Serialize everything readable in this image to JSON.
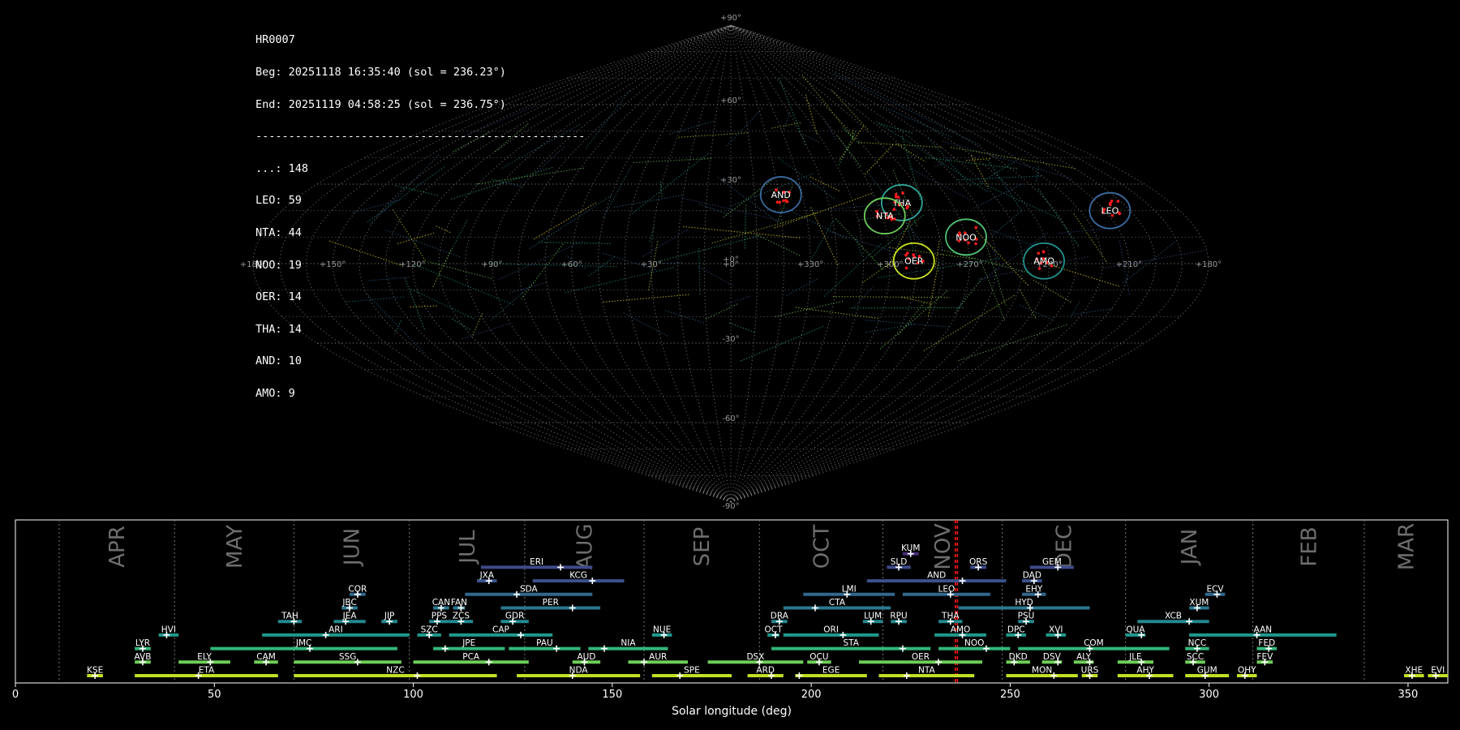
{
  "info": {
    "station": "HR0007",
    "beg": "Beg: 20251118 16:35:40 (sol = 236.23°)",
    "end": "End: 20251119 04:58:25 (sol = 236.75°)",
    "separator": "--------------------------------------------------",
    "counts": [
      "...: 148",
      "LEO: 59",
      "NTA: 44",
      "NOO: 19",
      "OER: 14",
      "THA: 14",
      "AND: 10",
      "AMO: 9"
    ]
  },
  "sky_map": {
    "projection": "sinusoidal",
    "lat_labels": [
      "+90°",
      "+60°",
      "+30°",
      "+0°",
      "-30°",
      "-60°",
      "-90°"
    ],
    "lon_labels": [
      "+180°",
      "+150°",
      "+120°",
      "+90°",
      "+60°",
      "+30°",
      "+0°",
      "+330°",
      "+300°",
      "+270°",
      "+240°",
      "+210°",
      "+180°"
    ],
    "radiants": [
      {
        "code": "LEO",
        "ra": 152,
        "dec": 20
      },
      {
        "code": "THA",
        "ra": 70,
        "dec": 23
      },
      {
        "code": "AND",
        "ra": 21,
        "dec": 26
      },
      {
        "code": "NTA",
        "ra": 61,
        "dec": 18
      },
      {
        "code": "NOO",
        "ra": 90,
        "dec": 10
      },
      {
        "code": "AMO",
        "ra": 118,
        "dec": 1
      },
      {
        "code": "OER",
        "ra": 69,
        "dec": 1
      }
    ],
    "colors": {
      "LEO": "#3b6ba0",
      "THA": "#2ea79a",
      "AND": "#3b6ba0",
      "NTA": "#6ccc5a",
      "NOO": "#4fbf74",
      "AMO": "#21918c",
      "OER": "#c9e21f"
    }
  },
  "chart_data": {
    "type": "timeline",
    "xlabel": "Solar longitude (deg)",
    "xlim": [
      0,
      360
    ],
    "xticks": [
      0,
      50,
      100,
      150,
      200,
      250,
      300,
      350
    ],
    "current_sol": [
      236.23,
      236.75
    ],
    "months": [
      {
        "name": "APR",
        "start": 11
      },
      {
        "name": "MAY",
        "start": 40
      },
      {
        "name": "JUN",
        "start": 70
      },
      {
        "name": "JUL",
        "start": 99
      },
      {
        "name": "AUG",
        "start": 128
      },
      {
        "name": "SEP",
        "start": 158
      },
      {
        "name": "OCT",
        "start": 187
      },
      {
        "name": "NOV",
        "start": 218
      },
      {
        "name": "DEC",
        "start": 248
      },
      {
        "name": "JAN",
        "start": 279
      },
      {
        "name": "FEB",
        "start": 311
      },
      {
        "name": "MAR",
        "start": 339
      }
    ],
    "showers": [
      {
        "code": "KUM",
        "start": 223,
        "end": 227,
        "peak": 225,
        "row": 10,
        "color": "#472d7b"
      },
      {
        "code": "ERI",
        "start": 117,
        "end": 145,
        "peak": 137,
        "row": 9,
        "color": "#3e4a89"
      },
      {
        "code": "SLD",
        "start": 219,
        "end": 225,
        "peak": 222,
        "row": 9,
        "color": "#3e4a89"
      },
      {
        "code": "ORS",
        "start": 240,
        "end": 244,
        "peak": 242,
        "row": 9,
        "color": "#3e4a89"
      },
      {
        "code": "GEM",
        "start": 255,
        "end": 266,
        "peak": 262,
        "row": 9,
        "color": "#3e4a89"
      },
      {
        "code": "JXA",
        "start": 116,
        "end": 121,
        "peak": 119,
        "row": 8,
        "color": "#3b528b"
      },
      {
        "code": "KCG",
        "start": 130,
        "end": 153,
        "peak": 145,
        "row": 8,
        "color": "#3b528b"
      },
      {
        "code": "AND",
        "start": 214,
        "end": 249,
        "peak": 238,
        "row": 8,
        "color": "#3b528b"
      },
      {
        "code": "DAD",
        "start": 253,
        "end": 258,
        "peak": 256,
        "row": 8,
        "color": "#3b528b"
      },
      {
        "code": "COR",
        "start": 84,
        "end": 88,
        "peak": 86,
        "row": 7,
        "color": "#31688e"
      },
      {
        "code": "SDA",
        "start": 113,
        "end": 145,
        "peak": 126,
        "row": 7,
        "color": "#31688e"
      },
      {
        "code": "LMI",
        "start": 198,
        "end": 221,
        "peak": 209,
        "row": 7,
        "color": "#31688e"
      },
      {
        "code": "LEO",
        "start": 223,
        "end": 245,
        "peak": 235,
        "row": 7,
        "color": "#31688e"
      },
      {
        "code": "EHY",
        "start": 253,
        "end": 259,
        "peak": 257,
        "row": 7,
        "color": "#31688e"
      },
      {
        "code": "ECV",
        "start": 299,
        "end": 304,
        "peak": 302,
        "row": 7,
        "color": "#31688e"
      },
      {
        "code": "JBC",
        "start": 82,
        "end": 86,
        "peak": 84,
        "row": 6,
        "color": "#2a788e"
      },
      {
        "code": "CAN",
        "start": 105,
        "end": 109,
        "peak": 107,
        "row": 6,
        "color": "#2a788e"
      },
      {
        "code": "FAN",
        "start": 110,
        "end": 113,
        "peak": 112,
        "row": 6,
        "color": "#2a788e"
      },
      {
        "code": "PER",
        "start": 122,
        "end": 147,
        "peak": 140,
        "row": 6,
        "color": "#2a788e"
      },
      {
        "code": "CTA",
        "start": 193,
        "end": 220,
        "peak": 201,
        "row": 6,
        "color": "#2a788e"
      },
      {
        "code": "HYD",
        "start": 237,
        "end": 270,
        "peak": 255,
        "row": 6,
        "color": "#2a788e"
      },
      {
        "code": "XUM",
        "start": 295,
        "end": 300,
        "peak": 297,
        "row": 6,
        "color": "#2a788e"
      },
      {
        "code": "TAH",
        "start": 66,
        "end": 72,
        "peak": 70,
        "row": 5,
        "color": "#23888e"
      },
      {
        "code": "JEA",
        "start": 80,
        "end": 88,
        "peak": 83,
        "row": 5,
        "color": "#23888e"
      },
      {
        "code": "JIP",
        "start": 92,
        "end": 96,
        "peak": 94,
        "row": 5,
        "color": "#23888e"
      },
      {
        "code": "PPS",
        "start": 104,
        "end": 109,
        "peak": 106,
        "row": 5,
        "color": "#23888e"
      },
      {
        "code": "ZCS",
        "start": 109,
        "end": 115,
        "peak": 112,
        "row": 5,
        "color": "#23888e"
      },
      {
        "code": "GDR",
        "start": 122,
        "end": 129,
        "peak": 125,
        "row": 5,
        "color": "#23888e"
      },
      {
        "code": "DRA",
        "start": 190,
        "end": 194,
        "peak": 192,
        "row": 5,
        "color": "#23888e"
      },
      {
        "code": "LUM",
        "start": 213,
        "end": 218,
        "peak": 215,
        "row": 5,
        "color": "#23888e"
      },
      {
        "code": "RPU",
        "start": 220,
        "end": 224,
        "peak": 222,
        "row": 5,
        "color": "#23888e"
      },
      {
        "code": "THA",
        "start": 232,
        "end": 238,
        "peak": 235,
        "row": 5,
        "color": "#23888e"
      },
      {
        "code": "PSU",
        "start": 252,
        "end": 256,
        "peak": 254,
        "row": 5,
        "color": "#23888e"
      },
      {
        "code": "XCB",
        "start": 282,
        "end": 300,
        "peak": 295,
        "row": 5,
        "color": "#23888e"
      },
      {
        "code": "HVI",
        "start": 36,
        "end": 41,
        "peak": 38,
        "row": 4,
        "color": "#1f988b"
      },
      {
        "code": "ARI",
        "start": 62,
        "end": 99,
        "peak": 78,
        "row": 4,
        "color": "#1f988b"
      },
      {
        "code": "SZC",
        "start": 101,
        "end": 107,
        "peak": 104,
        "row": 4,
        "color": "#1f988b"
      },
      {
        "code": "CAP",
        "start": 109,
        "end": 135,
        "peak": 127,
        "row": 4,
        "color": "#1f988b"
      },
      {
        "code": "NUE",
        "start": 160,
        "end": 165,
        "peak": 163,
        "row": 4,
        "color": "#1f988b"
      },
      {
        "code": "OCT",
        "start": 189,
        "end": 192,
        "peak": 191,
        "row": 4,
        "color": "#1f988b"
      },
      {
        "code": "ORI",
        "start": 193,
        "end": 217,
        "peak": 208,
        "row": 4,
        "color": "#1f988b"
      },
      {
        "code": "AMO",
        "start": 231,
        "end": 244,
        "peak": 238,
        "row": 4,
        "color": "#1f988b"
      },
      {
        "code": "DPC",
        "start": 249,
        "end": 254,
        "peak": 252,
        "row": 4,
        "color": "#1f988b"
      },
      {
        "code": "XVI",
        "start": 259,
        "end": 264,
        "peak": 262,
        "row": 4,
        "color": "#1f988b"
      },
      {
        "code": "QUA",
        "start": 279,
        "end": 284,
        "peak": 283,
        "row": 4,
        "color": "#1f988b"
      },
      {
        "code": "AAN",
        "start": 295,
        "end": 332,
        "peak": 312,
        "row": 4,
        "color": "#1f988b"
      },
      {
        "code": "LYR",
        "start": 30,
        "end": 34,
        "peak": 32,
        "row": 3,
        "color": "#35b779"
      },
      {
        "code": "JMC",
        "start": 49,
        "end": 96,
        "peak": 74,
        "row": 3,
        "color": "#35b779"
      },
      {
        "code": "JPE",
        "start": 105,
        "end": 123,
        "peak": 108,
        "row": 3,
        "color": "#35b779"
      },
      {
        "code": "PAU",
        "start": 124,
        "end": 142,
        "peak": 136,
        "row": 3,
        "color": "#35b779"
      },
      {
        "code": "NIA",
        "start": 144,
        "end": 164,
        "peak": 148,
        "row": 3,
        "color": "#35b779"
      },
      {
        "code": "STA",
        "start": 190,
        "end": 230,
        "peak": 223,
        "row": 3,
        "color": "#35b779"
      },
      {
        "code": "NOO",
        "start": 232,
        "end": 250,
        "peak": 244,
        "row": 3,
        "color": "#35b779"
      },
      {
        "code": "COM",
        "start": 252,
        "end": 290,
        "peak": 270,
        "row": 3,
        "color": "#35b779"
      },
      {
        "code": "NCC",
        "start": 294,
        "end": 300,
        "peak": 297,
        "row": 3,
        "color": "#35b779"
      },
      {
        "code": "FED",
        "start": 312,
        "end": 317,
        "peak": 315,
        "row": 3,
        "color": "#35b779"
      },
      {
        "code": "AVB",
        "start": 30,
        "end": 34,
        "peak": 32,
        "row": 2,
        "color": "#6ece58"
      },
      {
        "code": "ELY",
        "start": 41,
        "end": 54,
        "peak": 49,
        "row": 2,
        "color": "#6ece58"
      },
      {
        "code": "CAM",
        "start": 60,
        "end": 66,
        "peak": 63,
        "row": 2,
        "color": "#6ece58"
      },
      {
        "code": "SSG",
        "start": 70,
        "end": 97,
        "peak": 86,
        "row": 2,
        "color": "#6ece58"
      },
      {
        "code": "PCA",
        "start": 100,
        "end": 129,
        "peak": 119,
        "row": 2,
        "color": "#6ece58"
      },
      {
        "code": "AUD",
        "start": 140,
        "end": 147,
        "peak": 143,
        "row": 2,
        "color": "#6ece58"
      },
      {
        "code": "AUR",
        "start": 154,
        "end": 169,
        "peak": 158,
        "row": 2,
        "color": "#6ece58"
      },
      {
        "code": "DSX",
        "start": 174,
        "end": 198,
        "peak": 187,
        "row": 2,
        "color": "#6ece58"
      },
      {
        "code": "OCU",
        "start": 199,
        "end": 205,
        "peak": 202,
        "row": 2,
        "color": "#6ece58"
      },
      {
        "code": "OER",
        "start": 212,
        "end": 243,
        "peak": 232,
        "row": 2,
        "color": "#6ece58"
      },
      {
        "code": "DKD",
        "start": 249,
        "end": 255,
        "peak": 251,
        "row": 2,
        "color": "#6ece58"
      },
      {
        "code": "DSV",
        "start": 258,
        "end": 263,
        "peak": 262,
        "row": 2,
        "color": "#6ece58"
      },
      {
        "code": "ALY",
        "start": 266,
        "end": 271,
        "peak": 270,
        "row": 2,
        "color": "#6ece58"
      },
      {
        "code": "JLE",
        "start": 277,
        "end": 286,
        "peak": 283,
        "row": 2,
        "color": "#6ece58"
      },
      {
        "code": "SCC",
        "start": 294,
        "end": 299,
        "peak": 296,
        "row": 2,
        "color": "#6ece58"
      },
      {
        "code": "FEV",
        "start": 312,
        "end": 316,
        "peak": 314,
        "row": 2,
        "color": "#6ece58"
      },
      {
        "code": "KSE",
        "start": 18,
        "end": 22,
        "peak": 20,
        "row": 1,
        "color": "#c2df23"
      },
      {
        "code": "ETA",
        "start": 30,
        "end": 66,
        "peak": 46,
        "row": 1,
        "color": "#c2df23"
      },
      {
        "code": "NZC",
        "start": 70,
        "end": 121,
        "peak": 101,
        "row": 1,
        "color": "#c2df23"
      },
      {
        "code": "NDA",
        "start": 126,
        "end": 157,
        "peak": 140,
        "row": 1,
        "color": "#c2df23"
      },
      {
        "code": "SPE",
        "start": 160,
        "end": 180,
        "peak": 167,
        "row": 1,
        "color": "#c2df23"
      },
      {
        "code": "ARD",
        "start": 184,
        "end": 193,
        "peak": 190,
        "row": 1,
        "color": "#c2df23"
      },
      {
        "code": "EGE",
        "start": 196,
        "end": 214,
        "peak": 197,
        "row": 1,
        "color": "#c2df23"
      },
      {
        "code": "NTA",
        "start": 217,
        "end": 241,
        "peak": 224,
        "row": 1,
        "color": "#c2df23"
      },
      {
        "code": "MON",
        "start": 249,
        "end": 267,
        "peak": 261,
        "row": 1,
        "color": "#c2df23"
      },
      {
        "code": "URS",
        "start": 268,
        "end": 272,
        "peak": 270,
        "row": 1,
        "color": "#c2df23"
      },
      {
        "code": "AHY",
        "start": 277,
        "end": 291,
        "peak": 285,
        "row": 1,
        "color": "#c2df23"
      },
      {
        "code": "GUM",
        "start": 294,
        "end": 305,
        "peak": 299,
        "row": 1,
        "color": "#c2df23"
      },
      {
        "code": "OHY",
        "start": 307,
        "end": 312,
        "peak": 309,
        "row": 1,
        "color": "#c2df23"
      },
      {
        "code": "XHE",
        "start": 349,
        "end": 354,
        "peak": 351,
        "row": 1,
        "color": "#c2df23"
      },
      {
        "code": "EVI",
        "start": 355,
        "end": 360,
        "peak": 357,
        "row": 1,
        "color": "#c2df23"
      }
    ]
  }
}
